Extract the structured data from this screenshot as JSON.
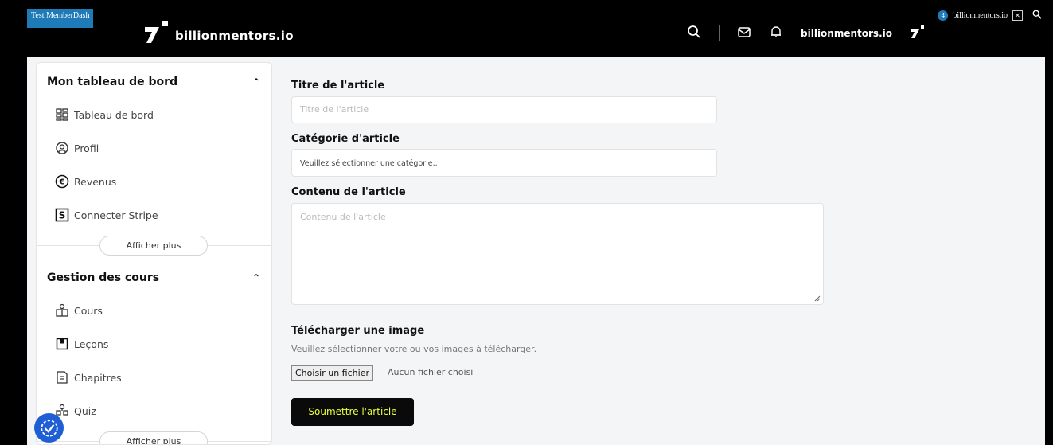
{
  "admin_bar": {
    "site_badge": "Test MemberDash",
    "notification_count": "4",
    "site_name": "billionmentors.io",
    "box_icon": "x-logo-icon",
    "search_icon": "search-icon"
  },
  "header": {
    "logo_text": "billionmentors.io",
    "user_name": "billionmentors.io",
    "icons": [
      "search-icon",
      "mail-icon",
      "bell-icon"
    ]
  },
  "sidebar": {
    "section1": {
      "title": "Mon tableau de bord",
      "items": [
        {
          "label": "Tableau de bord",
          "icon": "dashboard-icon"
        },
        {
          "label": "Profil",
          "icon": "user-circle-icon"
        },
        {
          "label": "Revenus",
          "icon": "euro-icon"
        },
        {
          "label": "Connecter Stripe",
          "icon": "stripe-icon"
        }
      ],
      "more_label": "Afficher plus"
    },
    "section2": {
      "title": "Gestion des cours",
      "items": [
        {
          "label": "Cours",
          "icon": "courses-icon"
        },
        {
          "label": "Leçons",
          "icon": "lesson-icon"
        },
        {
          "label": "Chapitres",
          "icon": "chapter-icon"
        },
        {
          "label": "Quiz",
          "icon": "quiz-icon"
        }
      ],
      "more_label": "Afficher plus"
    }
  },
  "form": {
    "title_label": "Titre de l'article",
    "title_placeholder": "Titre de l'article",
    "category_label": "Catégorie d'article",
    "category_value": "Veuillez sélectionner une catégorie..",
    "content_label": "Contenu de l'article",
    "content_placeholder": "Contenu de l'article",
    "upload_label": "Télécharger une image",
    "upload_help": "Veuillez sélectionner votre ou vos images à télécharger.",
    "file_button": "Choisir un fichier",
    "file_status": "Aucun fichier choisi",
    "submit_label": "Soumettre l'article"
  },
  "colors": {
    "accent_blue": "#1e7bb8",
    "submit_text": "#e8ff3a",
    "background": "#f4f5f7"
  }
}
